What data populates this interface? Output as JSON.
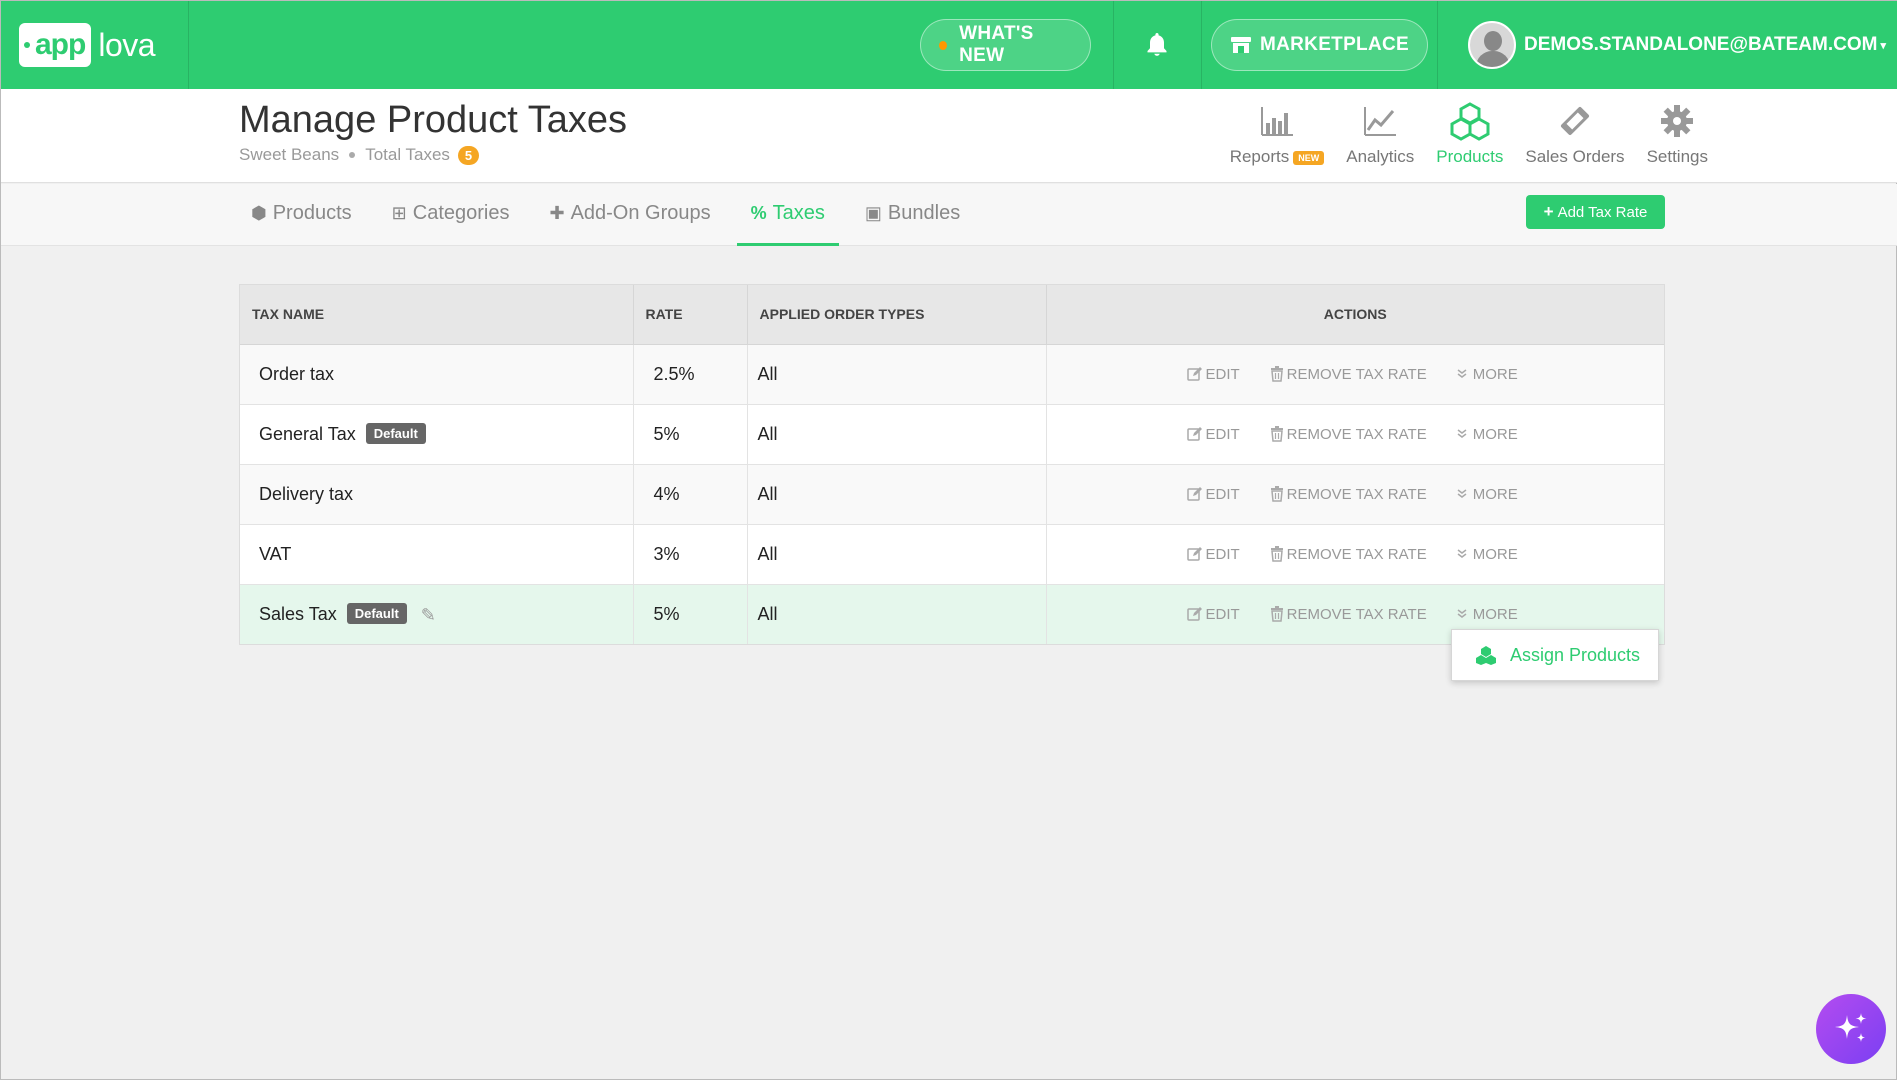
{
  "topbar": {
    "logo_app": "app",
    "logo_lova": "lova",
    "whats_new": "WHAT'S NEW",
    "marketplace": "MARKETPLACE",
    "user_email": "DEMOS.STANDALONE@BATEAM.COM"
  },
  "header": {
    "title": "Manage Product Taxes",
    "store": "Sweet Beans",
    "total_taxes_label": "Total Taxes",
    "total_taxes_count": "5",
    "nav": {
      "reports": "Reports",
      "reports_badge": "NEW",
      "analytics": "Analytics",
      "products": "Products",
      "sales_orders": "Sales Orders",
      "settings": "Settings"
    }
  },
  "tabs": {
    "products": "Products",
    "categories": "Categories",
    "addon_groups": "Add-On Groups",
    "taxes": "Taxes",
    "bundles": "Bundles",
    "add_tax_rate": "Add Tax Rate"
  },
  "table": {
    "headers": {
      "tax_name": "TAX NAME",
      "rate": "RATE",
      "applied_order_types": "APPLIED ORDER TYPES",
      "actions": "ACTIONS"
    },
    "default_badge": "Default",
    "action_labels": {
      "edit": "EDIT",
      "remove": "REMOVE TAX RATE",
      "more": "MORE"
    },
    "rows": [
      {
        "name": "Order tax",
        "rate": "2.5%",
        "types": "All",
        "default": false
      },
      {
        "name": "General Tax",
        "rate": "5%",
        "types": "All",
        "default": true
      },
      {
        "name": "Delivery tax",
        "rate": "4%",
        "types": "All",
        "default": false
      },
      {
        "name": "VAT",
        "rate": "3%",
        "types": "All",
        "default": false
      },
      {
        "name": "Sales Tax",
        "rate": "5%",
        "types": "All",
        "default": true
      }
    ]
  },
  "dropdown": {
    "assign_products": "Assign Products"
  },
  "colors": {
    "brand_green": "#2ecc71",
    "badge_orange": "#f5a623",
    "highlight_row": "#e5f7ec"
  }
}
